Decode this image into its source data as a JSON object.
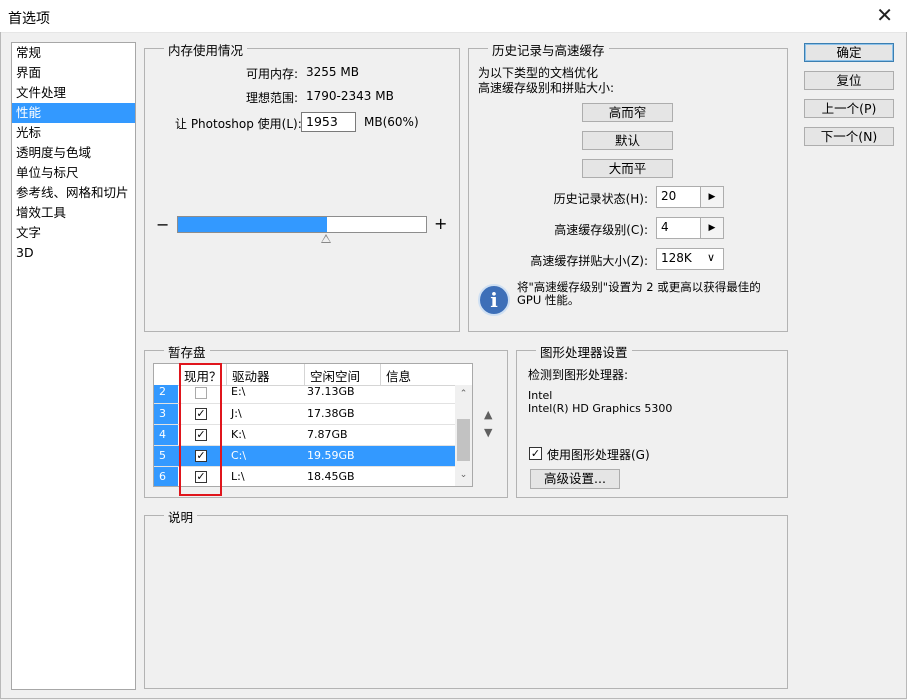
{
  "window": {
    "title": "首选项",
    "close_glyph": "✕"
  },
  "nav": {
    "items": [
      {
        "label": "常规"
      },
      {
        "label": "界面"
      },
      {
        "label": "文件处理"
      },
      {
        "label": "性能"
      },
      {
        "label": "光标"
      },
      {
        "label": "透明度与色域"
      },
      {
        "label": "单位与标尺"
      },
      {
        "label": "参考线、网格和切片"
      },
      {
        "label": "增效工具"
      },
      {
        "label": "文字"
      },
      {
        "label": "3D"
      }
    ],
    "selected": "性能"
  },
  "memory": {
    "title": "内存使用情况",
    "available_label": "可用内存:",
    "available_value": "3255 MB",
    "ideal_label": "理想范围:",
    "ideal_value": "1790-2343 MB",
    "let_label": "让 Photoshop 使用(L):",
    "input_value": "1953",
    "unit_label": "MB(60%)",
    "minus": "−",
    "plus": "+",
    "percent": 60
  },
  "history": {
    "title": "历史记录与高速缓存",
    "desc_line1": "为以下类型的文档优化",
    "desc_line2": "高速缓存级别和拼贴大小:",
    "btn_tall_thin": "高而窄",
    "btn_default": "默认",
    "btn_big_flat": "大而平",
    "states_label": "历史记录状态(H):",
    "states_value": "20",
    "levels_label": "高速缓存级别(C):",
    "levels_value": "4",
    "tile_label": "高速缓存拼贴大小(Z):",
    "tile_value": "128K",
    "info_line1": "将\"高速缓存级别\"设置为 2 或更高以获得最佳的",
    "info_line2": "GPU 性能。",
    "arrow": "▶",
    "dropdown_arrow": "∨"
  },
  "scratch": {
    "title": "暂存盘",
    "headers": {
      "active": "现用？",
      "drive": "驱动器",
      "free": "空闲空间",
      "info": "信息"
    },
    "rows": [
      {
        "num": "2",
        "checked": false,
        "drive": "E:\\",
        "free": "37.13GB"
      },
      {
        "num": "3",
        "checked": true,
        "drive": "J:\\",
        "free": "17.38GB"
      },
      {
        "num": "4",
        "checked": true,
        "drive": "K:\\",
        "free": "7.87GB"
      },
      {
        "num": "5",
        "checked": true,
        "drive": "C:\\",
        "free": "19.59GB",
        "selected": true
      },
      {
        "num": "6",
        "checked": true,
        "drive": "L:\\",
        "free": "18.45GB"
      }
    ],
    "check_glyph": "✓",
    "move_up": "▲",
    "move_down": "▼"
  },
  "gpu": {
    "title": "图形处理器设置",
    "detected_label": "检测到图形处理器:",
    "vendor": "Intel",
    "model": "Intel(R) HD Graphics 5300",
    "use_gpu_label": "使用图形处理器(G)",
    "use_gpu_checked": true,
    "advanced_button": "高级设置..."
  },
  "description": {
    "title": "说明"
  },
  "buttons": {
    "ok": "确定",
    "reset": "复位",
    "prev": "上一个(P)",
    "next": "下一个(N)"
  },
  "colors": {
    "accent": "#3399ff",
    "highlight_box": "#e0151c"
  }
}
